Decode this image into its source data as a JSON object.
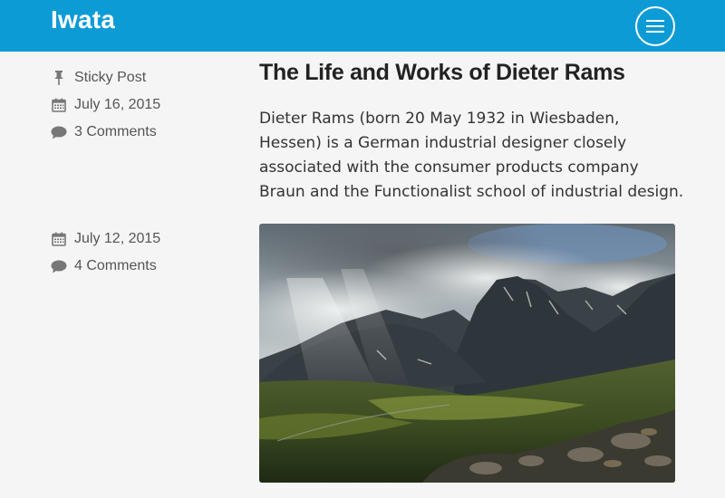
{
  "site": {
    "title": "Iwata"
  },
  "header": {
    "menu_icon": "hamburger-menu-icon"
  },
  "posts": [
    {
      "sticky_label": "Sticky Post",
      "date": "July 16, 2015",
      "comments": "3 Comments",
      "title": "The Life and Works of Dieter Rams",
      "excerpt": "Dieter Rams (born 20 May 1932 in Wiesbaden, Hessen) is a German industrial designer closely associated with the consumer products company Braun and the Functionalist school of industrial design."
    },
    {
      "date": "July 12, 2015",
      "comments": "4 Comments",
      "image_subject": "mountain-landscape"
    }
  ],
  "colors": {
    "header_bg": "#0d9bd6",
    "page_bg": "#f5f5f5",
    "meta_text": "#555555"
  }
}
